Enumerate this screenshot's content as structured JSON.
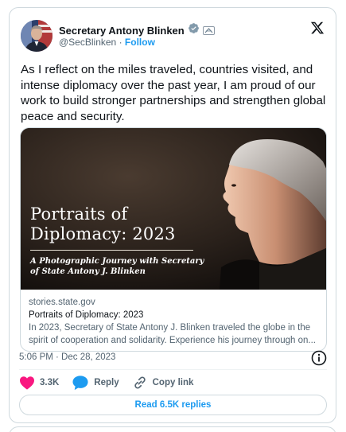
{
  "author": {
    "name": "Secretary Antony Blinken",
    "handle": "@SecBlinken",
    "separator": "·",
    "follow_label": "Follow"
  },
  "tweet": {
    "text": "As I reflect on the miles traveled, countries visited, and intense diplomacy over the past year, I am proud of our work to build stronger partnerships and strengthen global peace and security.",
    "timestamp": "5:06 PM · Dec 28, 2023"
  },
  "link_card": {
    "image_title": "Portraits of Diplomacy: 2023",
    "image_subtitle": "A Photographic Journey with Secretary of State Antony J. Blinken",
    "domain": "stories.state.gov",
    "title": "Portraits of Diplomacy: 2023",
    "description": "In 2023, Secretary of State Antony J. Blinken traveled the globe in the spirit of cooperation and solidarity. Experience his journey through on..."
  },
  "actions": {
    "likes": "3.3K",
    "reply_label": "Reply",
    "copy_link_label": "Copy link"
  },
  "replies_button": "Read 6.5K replies",
  "icons": [
    "verified-icon",
    "government-badge-icon",
    "x-logo-icon",
    "info-icon",
    "heart-icon",
    "reply-icon",
    "link-icon"
  ],
  "colors": {
    "accent": "#1d9bf0",
    "like": "#f91880",
    "text": "#0f1419",
    "muted": "#536471",
    "border": "#cfd9de"
  }
}
